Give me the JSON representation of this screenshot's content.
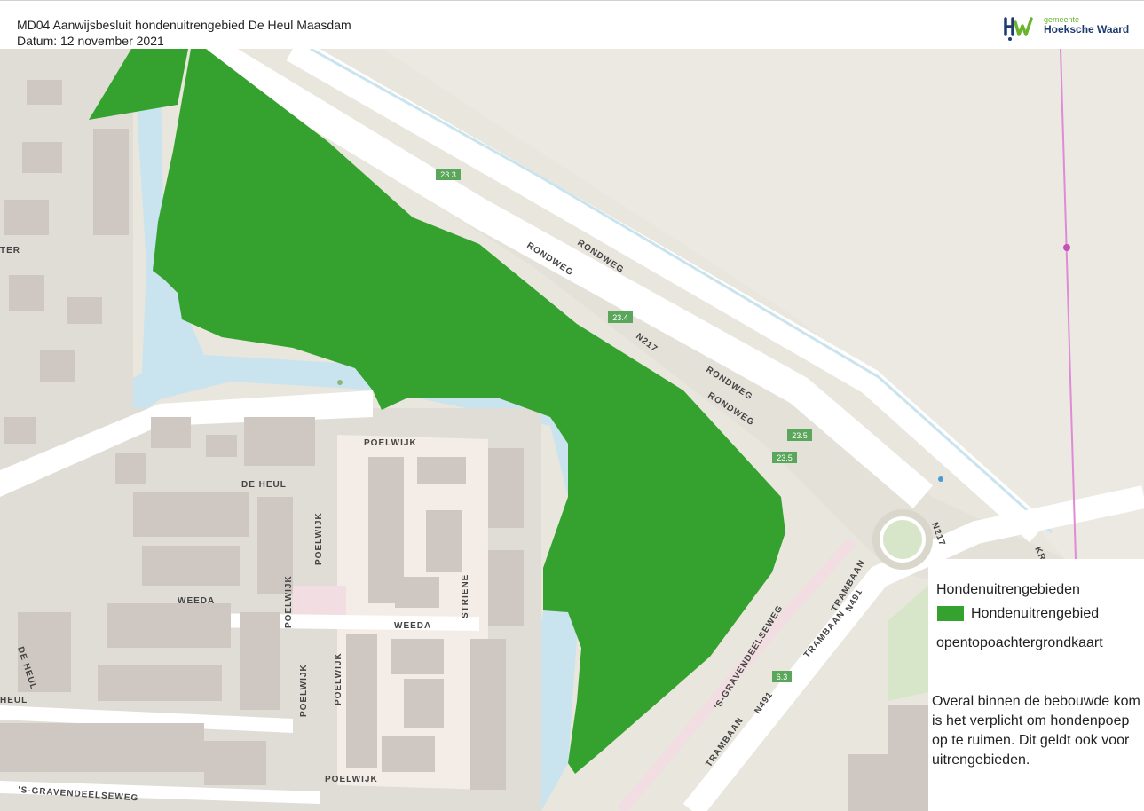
{
  "header": {
    "title": "MD04 Aanwijsbesluit hondenuitrengebied De Heul Maasdam",
    "date": "Datum: 12 november 2021"
  },
  "logo": {
    "small": "gemeente",
    "name": "Hoeksche Waard",
    "colors": {
      "mark_blue": "#1e3a6e",
      "mark_green": "#6ab42d"
    }
  },
  "map": {
    "colors": {
      "dog_area": "#35a22f",
      "water": "#c9e4ee",
      "land": "#e8e6dd",
      "road": "#ffffff",
      "building": "#cfc8c2",
      "greenery": "#d7e6c8"
    },
    "route_labels": [
      "23.3",
      "23.4",
      "23.5",
      "23.5",
      "6.3"
    ],
    "road_labels": [
      "RONDWEG",
      "RONDWEG",
      "N217",
      "RONDWEG",
      "RONDWEG",
      "N217",
      "TRAMBAAN",
      "N491",
      "TRAMBAAN",
      "N491",
      "TRAMBAAN",
      "'S-GRAVENDEELSEWEG",
      "DE HEUL",
      "POELWIJK",
      "WEEDA",
      "WEEDA",
      "POELWIJK",
      "POELWIJK",
      "POELWIJK",
      "POELWIJK",
      "STRIENE",
      "DE HEUL",
      "HEUL",
      "POELWIJK",
      "'S-GRAVENDEELSEWEG",
      "TER",
      "KR"
    ]
  },
  "legend": {
    "title": "Hondenuitrengebieden",
    "item_label": "Hondenuitrengebied",
    "basemap": "opentopoachtergrondkaart",
    "note": "Overal binnen de bebouwde kom is het verplicht om hondenpoep op te ruimen. Dit geldt ook voor uitrengebieden."
  }
}
